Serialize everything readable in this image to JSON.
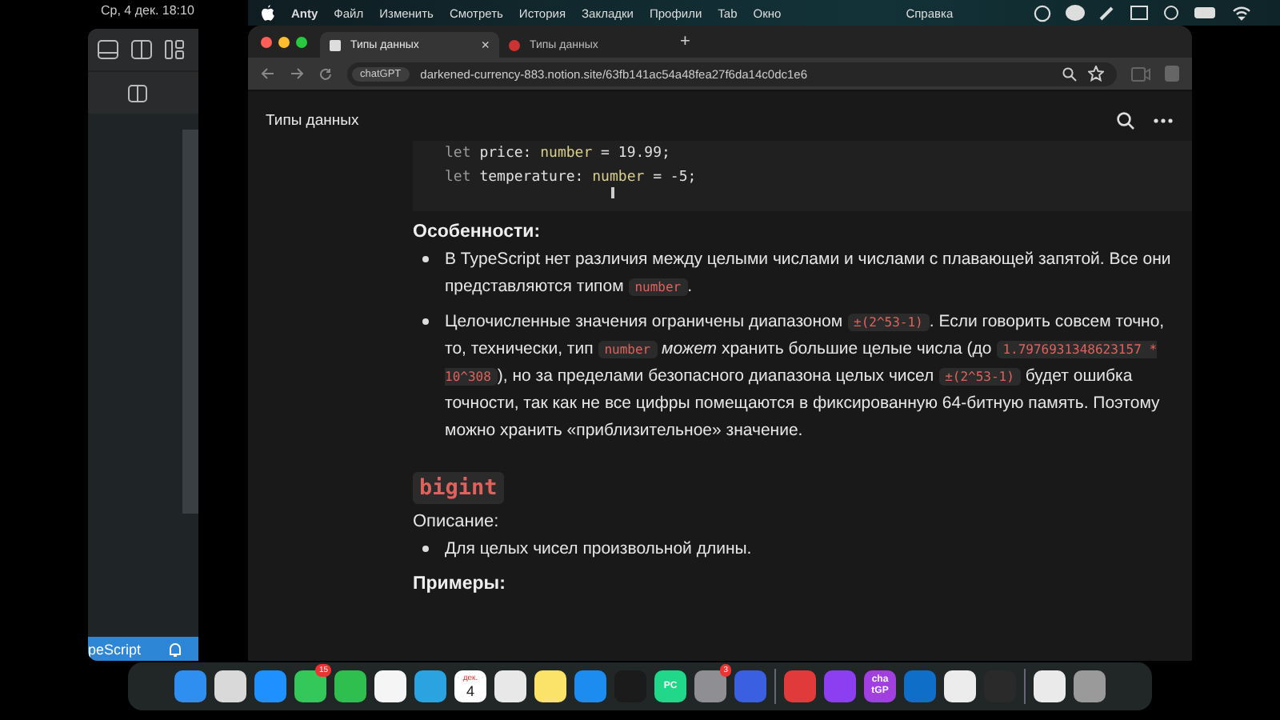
{
  "clock": {
    "text": "Ср, 4 дек. 18:10"
  },
  "menu_bar": {
    "items": [
      "Anty",
      "Файл",
      "Изменить",
      "Смотреть",
      "История",
      "Закладки",
      "Профили",
      "Tab",
      "Окно",
      "Справка"
    ]
  },
  "editor": {
    "status_text": "peScript"
  },
  "browser": {
    "tabs": [
      {
        "label": "Типы данных",
        "selected": true,
        "close": "×"
      },
      {
        "label": "Типы данных",
        "selected": false
      }
    ],
    "new_tab": "+",
    "address": {
      "chip": "chatGPT",
      "url": "darkened-currency-883.notion.site/63fb141ac54a48fea27f6da14c0dc1e6"
    }
  },
  "page": {
    "title": "Типы данных",
    "code_lines": [
      [
        {
          "kind": "kw",
          "text": "let "
        },
        {
          "kind": "plain",
          "text": "price: "
        },
        {
          "kind": "type",
          "text": "number"
        },
        {
          "kind": "plain",
          "text": " = "
        },
        {
          "kind": "num",
          "text": "19.99"
        },
        {
          "kind": "plain",
          "text": ";"
        }
      ],
      [
        {
          "kind": "kw",
          "text": "let "
        },
        {
          "kind": "plain",
          "text": "temperature: "
        },
        {
          "kind": "type",
          "text": "number"
        },
        {
          "kind": "plain",
          "text": " = "
        },
        {
          "kind": "num",
          "text": "-5"
        },
        {
          "kind": "plain",
          "text": ";"
        }
      ]
    ],
    "blocks": [
      {
        "kind": "heading",
        "text": "Особенности:"
      },
      {
        "kind": "bullet",
        "parts": [
          {
            "kind": "text",
            "text": "В TypeScript нет различия между целыми числами и числами с плавающей запятой. Все они представляются типом "
          },
          {
            "kind": "code",
            "text": "number"
          },
          {
            "kind": "text",
            "text": "."
          }
        ]
      },
      {
        "kind": "bullet",
        "parts": [
          {
            "kind": "text",
            "text": "Целочисленные значения ограничены диапазоном "
          },
          {
            "kind": "code",
            "text": "±(2^53-1)"
          },
          {
            "kind": "text",
            "text": ". Если говорить совсем точно, то, технически, тип "
          },
          {
            "kind": "code",
            "text": "number"
          },
          {
            "kind": "text",
            "text": " *может* хранить большие целые числа (до "
          },
          {
            "kind": "code",
            "text": "1.7976931348623157 * 10^308"
          },
          {
            "kind": "text",
            "text": "), но за пределами безопасного диапазона целых чисел "
          },
          {
            "kind": "code",
            "text": "±(2^53-1)"
          },
          {
            "kind": "text",
            "text": " будет ошибка точности, так как не все цифры помещаются в фиксированную 64-битную память. Поэтому можно хранить «приблизительное» значение."
          }
        ]
      },
      {
        "kind": "code_heading",
        "text": "bigint"
      },
      {
        "kind": "label",
        "text": "Описание:"
      },
      {
        "kind": "bullet",
        "parts": [
          {
            "kind": "text",
            "text": "Для целых чисел произвольной длины."
          }
        ]
      },
      {
        "kind": "heading",
        "text": "Примеры:"
      }
    ]
  },
  "dock": {
    "apps": [
      {
        "color": "#2f8ff0"
      },
      {
        "color": "#d9d9d9"
      },
      {
        "color": "#1e90ff"
      },
      {
        "color": "#34c759",
        "badge": "15"
      },
      {
        "color": "#2fbf4f"
      },
      {
        "color": "#f5f5f5"
      },
      {
        "color": "#2aa3e0"
      },
      {
        "color": "#ffffff",
        "month": "дек.",
        "day": "4"
      },
      {
        "color": "#e8e8e8"
      },
      {
        "color": "#fbe36a"
      },
      {
        "color": "#1d8cf0"
      },
      {
        "color": "#1b1b1b"
      },
      {
        "color": "#21d789",
        "label": "PC"
      },
      {
        "color": "#8e8e93",
        "badge": "3"
      },
      {
        "color": "#3a5fe0"
      },
      {
        "color": "#e03a3a"
      },
      {
        "color": "#8b3ff0"
      },
      {
        "color": "#a23fe0",
        "label": "cha tGP"
      },
      {
        "color": "#0f6fc8"
      },
      {
        "color": "#ececec"
      },
      {
        "color": "#2a2a2a"
      },
      {
        "color": "#eaeaea"
      },
      {
        "color": "#9a9a9a"
      }
    ]
  }
}
